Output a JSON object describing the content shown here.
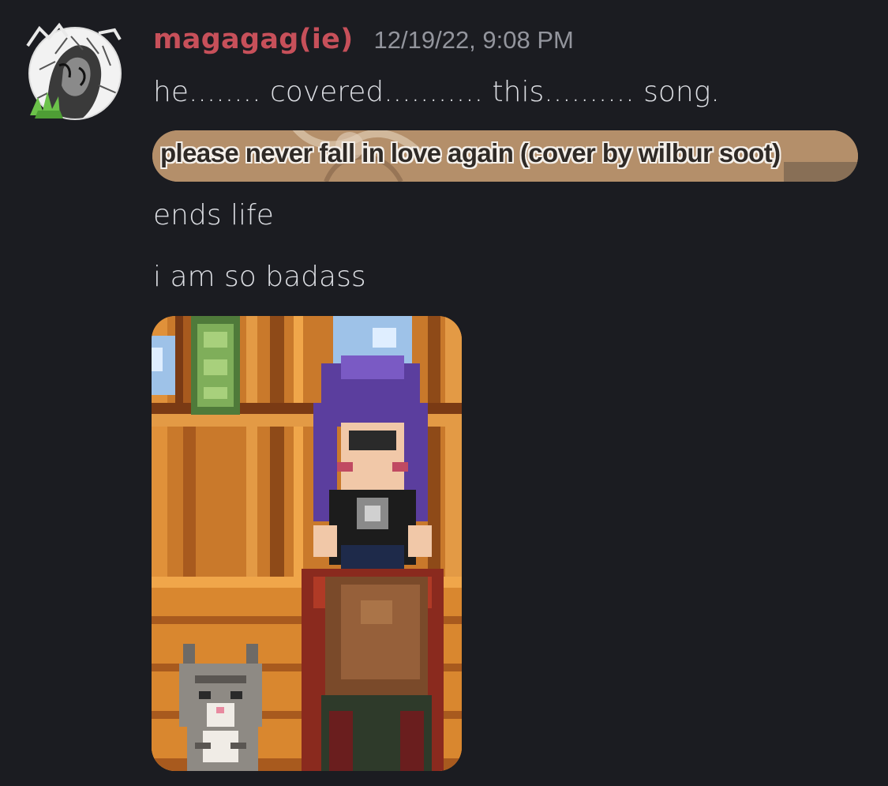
{
  "message": {
    "author": "magagag(ie)",
    "timestamp": "12/19/22, 9:08 PM",
    "author_color": "#c7505a",
    "lines": [
      "he........ covered........... this.......... song.",
      "ends life",
      "i am so badass"
    ],
    "sticker_text": "please never fall in love again (cover by wilbur soot)",
    "attachment_type": "image"
  },
  "icons": {
    "avatar": "drawn-avatar-icon"
  }
}
